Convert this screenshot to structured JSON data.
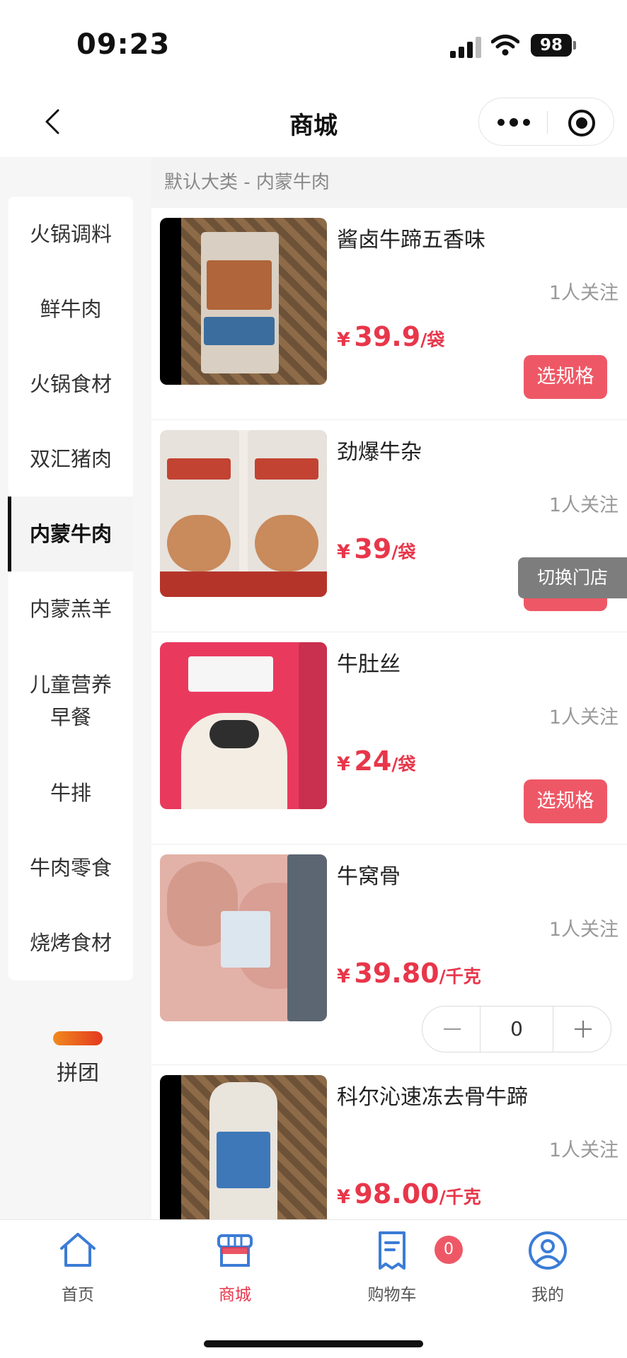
{
  "status_bar": {
    "time": "09:23",
    "battery": "98"
  },
  "nav": {
    "title": "商城",
    "back_icon": "chevron-left-icon",
    "more_icon": "more-dots-icon",
    "close_icon": "record-target-icon"
  },
  "sidebar": {
    "categories": [
      {
        "label": "火锅调料"
      },
      {
        "label": "鲜牛肉"
      },
      {
        "label": "火锅食材"
      },
      {
        "label": "双汇猪肉"
      },
      {
        "label": "内蒙牛肉",
        "active": true
      },
      {
        "label": "内蒙羔羊"
      },
      {
        "label_line1": "儿童营养",
        "label_line2": "早餐"
      },
      {
        "label": "牛排"
      },
      {
        "label": "牛肉零食"
      },
      {
        "label": "烧烤食材"
      }
    ],
    "group_buy": {
      "label": "拼团"
    }
  },
  "content": {
    "breadcrumb": "默认大类 - 内蒙牛肉",
    "switch_store": "切换门店",
    "products": [
      {
        "name": "酱卤牛蹄五香味",
        "follow": "1人关注",
        "currency": "¥",
        "price": "39.9",
        "unit": "/袋",
        "action": "选规格"
      },
      {
        "name": "劲爆牛杂",
        "follow": "1人关注",
        "currency": "¥",
        "price": "39",
        "unit": "/袋",
        "action": "选规格"
      },
      {
        "name": "牛肚丝",
        "follow": "1人关注",
        "currency": "¥",
        "price": "24",
        "unit": "/袋",
        "action": "选规格"
      },
      {
        "name": "牛窝骨",
        "follow": "1人关注",
        "currency": "¥",
        "price": "39.80",
        "unit": "/千克",
        "quantity": "0"
      },
      {
        "name": "科尔沁速冻去骨牛蹄",
        "follow": "1人关注",
        "currency": "¥",
        "price": "98.00",
        "unit": "/千克"
      }
    ]
  },
  "tabbar": {
    "tabs": [
      {
        "label": "首页",
        "icon": "home-icon"
      },
      {
        "label": "商城",
        "icon": "store-icon",
        "active": true
      },
      {
        "label": "购物车",
        "icon": "cart-receipt-icon"
      },
      {
        "label": "我的",
        "icon": "profile-icon"
      }
    ],
    "cart_count": "0"
  },
  "colors": {
    "accent": "#e8364a",
    "button": "#ee5866",
    "tab_icon": "#3b7cd6"
  }
}
